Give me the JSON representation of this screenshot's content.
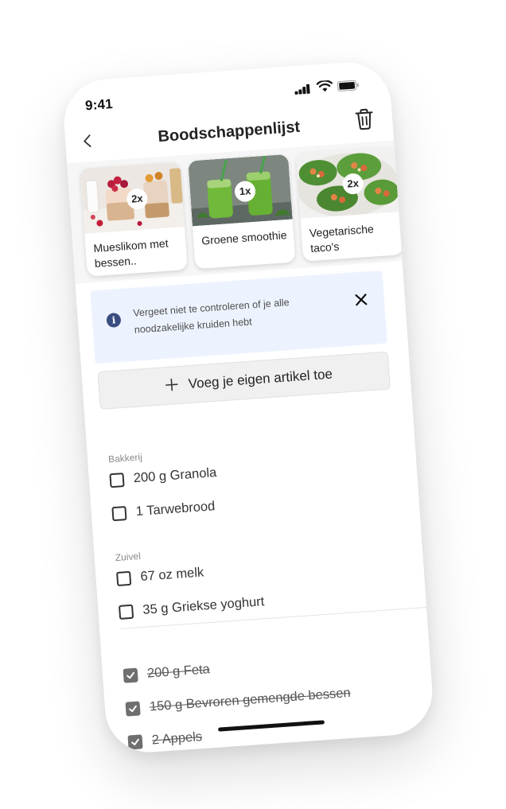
{
  "status_bar": {
    "time": "9:41"
  },
  "header": {
    "title": "Boodschappenlijst"
  },
  "recipes": [
    {
      "name": "Mueslikom met bessen..",
      "count": "2x"
    },
    {
      "name": "Groene smoothie",
      "count": "1x"
    },
    {
      "name": "Vegetarische taco's",
      "count": "2x"
    }
  ],
  "banner": {
    "text": "Vergeet niet te controleren of je alle noodzakelijke kruiden hebt"
  },
  "add_item": {
    "label": "Voeg je eigen artikel toe"
  },
  "sections": [
    {
      "label": "Bakkerij",
      "items": [
        "200 g Granola",
        "1 Tarwebrood"
      ]
    },
    {
      "label": "Zuivel",
      "items": [
        "67 oz melk",
        "35 g Griekse yoghurt"
      ]
    }
  ],
  "done_items": [
    "200 g Feta",
    "150 g Bevroren gemengde bessen",
    "2 Appels"
  ],
  "colors": {
    "banner_bg": "#edf3fe",
    "info_icon": "#3a4d80",
    "checked": "#6f6f6f"
  }
}
